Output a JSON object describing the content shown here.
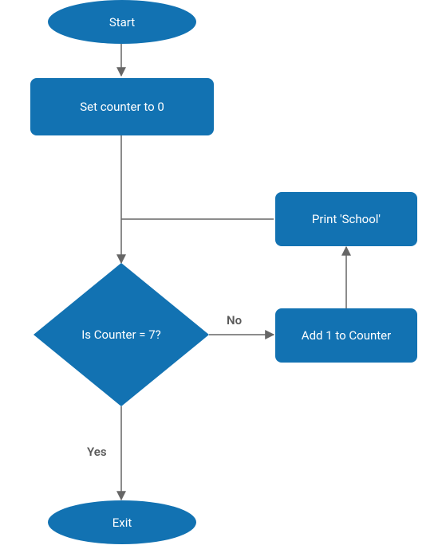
{
  "nodes": {
    "start": {
      "label": "Start"
    },
    "set_counter": {
      "label": "Set counter to 0"
    },
    "decision": {
      "label": "Is Counter = 7?"
    },
    "add_counter": {
      "label": "Add 1 to Counter"
    },
    "print_school": {
      "label": "Print 'School'"
    },
    "exit": {
      "label": "Exit"
    }
  },
  "edges": {
    "yes": "Yes",
    "no": "No"
  },
  "colors": {
    "node_fill": "#1272b2",
    "arrow": "#666666"
  },
  "chart_data": {
    "type": "flowchart",
    "nodes": [
      {
        "id": "start",
        "type": "terminator",
        "label": "Start"
      },
      {
        "id": "set_counter",
        "type": "process",
        "label": "Set counter to 0"
      },
      {
        "id": "decision",
        "type": "decision",
        "label": "Is Counter = 7?"
      },
      {
        "id": "add_counter",
        "type": "process",
        "label": "Add 1 to Counter"
      },
      {
        "id": "print_school",
        "type": "process",
        "label": "Print 'School'"
      },
      {
        "id": "exit",
        "type": "terminator",
        "label": "Exit"
      }
    ],
    "edges": [
      {
        "from": "start",
        "to": "set_counter"
      },
      {
        "from": "set_counter",
        "to": "decision"
      },
      {
        "from": "decision",
        "to": "exit",
        "label": "Yes"
      },
      {
        "from": "decision",
        "to": "add_counter",
        "label": "No"
      },
      {
        "from": "add_counter",
        "to": "print_school"
      },
      {
        "from": "print_school",
        "to": "decision"
      }
    ]
  }
}
